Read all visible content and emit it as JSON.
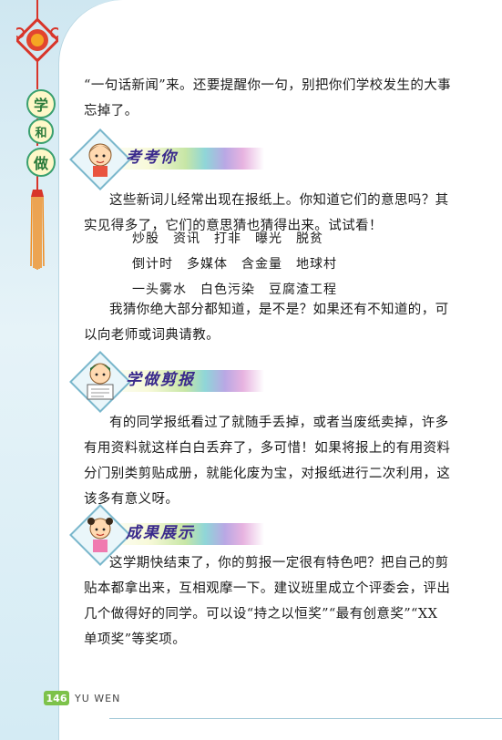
{
  "sidebar": {
    "badge_1": "学",
    "badge_2": "和",
    "badge_3": "做"
  },
  "intro": {
    "line1": "“一句话新闻”来。还要提醒你一句，别把你们学校发生的大事",
    "line2": "忘掉了。"
  },
  "section1": {
    "title": "考考你",
    "para1_line1": "这些新词儿经常出现在报纸上。你知道它们的意思吗？其",
    "para1_line2": "实见得多了，它们的意思猜也猜得出来。试试看！",
    "words_row1": "炒股　资讯　打非　曝光　脱贫",
    "words_row2": "倒计时　多媒体　含金量　地球村",
    "words_row3": "一头雾水　白色污染　豆腐渣工程",
    "para2_line1": "我猜你绝大部分都知道，是不是？如果还有不知道的，可",
    "para2_line2": "以向老师或词典请教。"
  },
  "section2": {
    "title": "学做剪报",
    "line1": "有的同学报纸看过了就随手丢掉，或者当废纸卖掉，许多",
    "line2": "有用资料就这样白白丢弃了，多可惜！如果将报上的有用资料",
    "line3": "分门别类剪贴成册，就能化废为宝，对报纸进行二次利用，这",
    "line4": "该多有意义呀。"
  },
  "section3": {
    "title": "成果展示",
    "line1": "这学期快结束了，你的剪报一定很有特色吧？把自己的剪",
    "line2": "贴本都拿出来，互相观摩一下。建议班里成立个评委会，评出",
    "line3": "几个做得好的同学。可以设“持之以恒奖”“最有创意奖”“XX",
    "line4": "单项奖”等奖项。"
  },
  "footer": {
    "page_number": "146",
    "label": "YU WEN"
  },
  "colors": {
    "accent_green": "#7dc24a",
    "title_purple": "#3a2a8c",
    "side_blue": "#cfe7f1",
    "knot_red": "#d8352a"
  }
}
